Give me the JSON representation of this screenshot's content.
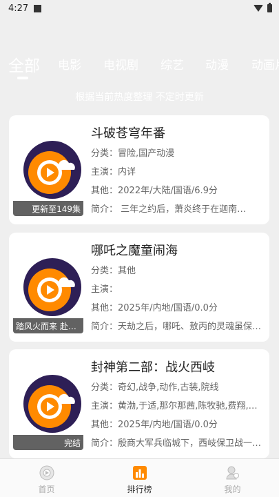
{
  "status": {
    "time": "4:27"
  },
  "tabs": [
    "全部",
    "电影",
    "电视剧",
    "综艺",
    "动漫",
    "动画片"
  ],
  "subtitle": "根据当前热度整理 不定时更新",
  "cards": [
    {
      "title": "斗破苍穹年番",
      "category": "分类：冒险,国产动漫",
      "cast": "主演：内详",
      "other": "其他：2022年/大陆/国语/6.9分",
      "intro": "简介：        三年之约后，萧炎终于在迦南…",
      "badge": "更新至149集"
    },
    {
      "title": "哪吒之魔童闹海",
      "category": "分类：其他",
      "cast": "主演：",
      "other": "其他：2025年/内地/国语/0.0分",
      "intro": "简介：天劫之后，哪吒、敖丙的灵魂虽保…",
      "badge": "踏风火而来 赴…"
    },
    {
      "title": "封神第二部：战火西岐",
      "category": "分类：奇幻,战争,动作,古装,院线",
      "cast": "主演：黄渤,于适,那尔那茜,陈牧驰,费翔,…",
      "other": "其他：2025年/内地/国语/0.0分",
      "intro": "简介：殷商大军兵临城下，西岐保卫战一…",
      "badge": "完结"
    }
  ],
  "nav": [
    {
      "label": "首页",
      "icon": "home-icon"
    },
    {
      "label": "排行榜",
      "icon": "chart-icon"
    },
    {
      "label": "我的",
      "icon": "profile-icon"
    }
  ],
  "colors": {
    "accent": "#ff7f00",
    "logo_purple": "#2e1f56",
    "active_nav": "#ff8a00"
  }
}
